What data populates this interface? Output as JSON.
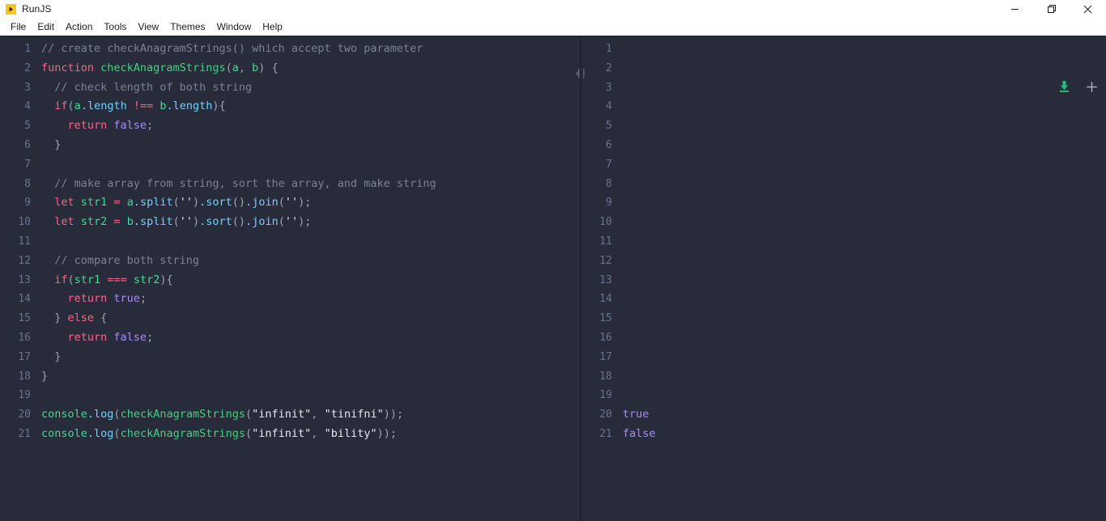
{
  "window": {
    "app_name": "RunJS",
    "app_icon": "play-icon",
    "controls": {
      "minimize": "minimize-icon",
      "maximize": "restore-icon",
      "close": "close-icon"
    }
  },
  "menubar": {
    "items": [
      {
        "label": "File"
      },
      {
        "label": "Edit"
      },
      {
        "label": "Action"
      },
      {
        "label": "Tools"
      },
      {
        "label": "View"
      },
      {
        "label": "Themes"
      },
      {
        "label": "Window"
      },
      {
        "label": "Help"
      }
    ]
  },
  "editor": {
    "line_numbers": [
      "1",
      "2",
      "3",
      "4",
      "5",
      "6",
      "7",
      "8",
      "9",
      "10",
      "11",
      "12",
      "13",
      "14",
      "15",
      "16",
      "17",
      "18",
      "19",
      "20",
      "21"
    ],
    "lines": [
      {
        "n": "1",
        "tokens": [
          {
            "t": "// create checkAnagramStrings() which accept two parameter",
            "c": "tok-comment"
          }
        ]
      },
      {
        "n": "2",
        "tokens": [
          {
            "t": "function ",
            "c": "tok-keyword"
          },
          {
            "t": "checkAnagramStrings",
            "c": "tok-func"
          },
          {
            "t": "(",
            "c": "tok-punct"
          },
          {
            "t": "a",
            "c": "tok-var"
          },
          {
            "t": ", ",
            "c": "tok-punct"
          },
          {
            "t": "b",
            "c": "tok-var"
          },
          {
            "t": ") {",
            "c": "tok-punct"
          }
        ]
      },
      {
        "n": "3",
        "tokens": [
          {
            "t": "  // check length of both string",
            "c": "tok-comment"
          }
        ]
      },
      {
        "n": "4",
        "tokens": [
          {
            "t": "  ",
            "c": "tok-plain"
          },
          {
            "t": "if",
            "c": "tok-keyword"
          },
          {
            "t": "(",
            "c": "tok-punct"
          },
          {
            "t": "a",
            "c": "tok-var"
          },
          {
            "t": ".length",
            "c": "tok-prop"
          },
          {
            "t": " !== ",
            "c": "tok-op"
          },
          {
            "t": "b",
            "c": "tok-var"
          },
          {
            "t": ".length",
            "c": "tok-prop"
          },
          {
            "t": "){",
            "c": "tok-punct"
          }
        ]
      },
      {
        "n": "5",
        "tokens": [
          {
            "t": "    ",
            "c": "tok-plain"
          },
          {
            "t": "return ",
            "c": "tok-keyword"
          },
          {
            "t": "false",
            "c": "tok-bool"
          },
          {
            "t": ";",
            "c": "tok-punct"
          }
        ]
      },
      {
        "n": "6",
        "tokens": [
          {
            "t": "  }",
            "c": "tok-punct"
          }
        ]
      },
      {
        "n": "7",
        "tokens": [
          {
            "t": "",
            "c": "tok-plain"
          }
        ]
      },
      {
        "n": "8",
        "tokens": [
          {
            "t": "  // make array from string, sort the array, and make string",
            "c": "tok-comment"
          }
        ]
      },
      {
        "n": "9",
        "tokens": [
          {
            "t": "  ",
            "c": "tok-plain"
          },
          {
            "t": "let ",
            "c": "tok-keyword"
          },
          {
            "t": "str1",
            "c": "tok-var"
          },
          {
            "t": " = ",
            "c": "tok-op"
          },
          {
            "t": "a",
            "c": "tok-var"
          },
          {
            "t": ".split",
            "c": "tok-prop"
          },
          {
            "t": "(",
            "c": "tok-punct"
          },
          {
            "t": "''",
            "c": "tok-string"
          },
          {
            "t": ")",
            "c": "tok-punct"
          },
          {
            "t": ".sort",
            "c": "tok-prop"
          },
          {
            "t": "()",
            "c": "tok-punct"
          },
          {
            "t": ".join",
            "c": "tok-prop"
          },
          {
            "t": "(",
            "c": "tok-punct"
          },
          {
            "t": "''",
            "c": "tok-string"
          },
          {
            "t": ");",
            "c": "tok-punct"
          }
        ]
      },
      {
        "n": "10",
        "tokens": [
          {
            "t": "  ",
            "c": "tok-plain"
          },
          {
            "t": "let ",
            "c": "tok-keyword"
          },
          {
            "t": "str2",
            "c": "tok-var"
          },
          {
            "t": " = ",
            "c": "tok-op"
          },
          {
            "t": "b",
            "c": "tok-var"
          },
          {
            "t": ".split",
            "c": "tok-prop"
          },
          {
            "t": "(",
            "c": "tok-punct"
          },
          {
            "t": "''",
            "c": "tok-string"
          },
          {
            "t": ")",
            "c": "tok-punct"
          },
          {
            "t": ".sort",
            "c": "tok-prop"
          },
          {
            "t": "()",
            "c": "tok-punct"
          },
          {
            "t": ".join",
            "c": "tok-prop"
          },
          {
            "t": "(",
            "c": "tok-punct"
          },
          {
            "t": "''",
            "c": "tok-string"
          },
          {
            "t": ");",
            "c": "tok-punct"
          }
        ]
      },
      {
        "n": "11",
        "tokens": [
          {
            "t": "",
            "c": "tok-plain"
          }
        ]
      },
      {
        "n": "12",
        "tokens": [
          {
            "t": "  // compare both string",
            "c": "tok-comment"
          }
        ]
      },
      {
        "n": "13",
        "tokens": [
          {
            "t": "  ",
            "c": "tok-plain"
          },
          {
            "t": "if",
            "c": "tok-keyword"
          },
          {
            "t": "(",
            "c": "tok-punct"
          },
          {
            "t": "str1",
            "c": "tok-var"
          },
          {
            "t": " === ",
            "c": "tok-op"
          },
          {
            "t": "str2",
            "c": "tok-var"
          },
          {
            "t": "){",
            "c": "tok-punct"
          }
        ]
      },
      {
        "n": "14",
        "tokens": [
          {
            "t": "    ",
            "c": "tok-plain"
          },
          {
            "t": "return ",
            "c": "tok-keyword"
          },
          {
            "t": "true",
            "c": "tok-bool"
          },
          {
            "t": ";",
            "c": "tok-punct"
          }
        ]
      },
      {
        "n": "15",
        "tokens": [
          {
            "t": "  } ",
            "c": "tok-punct"
          },
          {
            "t": "else",
            "c": "tok-keyword"
          },
          {
            "t": " {",
            "c": "tok-punct"
          }
        ]
      },
      {
        "n": "16",
        "tokens": [
          {
            "t": "    ",
            "c": "tok-plain"
          },
          {
            "t": "return ",
            "c": "tok-keyword"
          },
          {
            "t": "false",
            "c": "tok-bool"
          },
          {
            "t": ";",
            "c": "tok-punct"
          }
        ]
      },
      {
        "n": "17",
        "tokens": [
          {
            "t": "  }",
            "c": "tok-punct"
          }
        ]
      },
      {
        "n": "18",
        "tokens": [
          {
            "t": "}",
            "c": "tok-punct"
          }
        ]
      },
      {
        "n": "19",
        "tokens": [
          {
            "t": "",
            "c": "tok-plain"
          }
        ]
      },
      {
        "n": "20",
        "tokens": [
          {
            "t": "console",
            "c": "tok-var"
          },
          {
            "t": ".log",
            "c": "tok-prop"
          },
          {
            "t": "(",
            "c": "tok-punct"
          },
          {
            "t": "checkAnagramStrings",
            "c": "tok-func"
          },
          {
            "t": "(",
            "c": "tok-punct"
          },
          {
            "t": "\"infinit\"",
            "c": "tok-string"
          },
          {
            "t": ", ",
            "c": "tok-punct"
          },
          {
            "t": "\"tinifni\"",
            "c": "tok-string"
          },
          {
            "t": "));",
            "c": "tok-punct"
          }
        ]
      },
      {
        "n": "21",
        "tokens": [
          {
            "t": "console",
            "c": "tok-var"
          },
          {
            "t": ".log",
            "c": "tok-prop"
          },
          {
            "t": "(",
            "c": "tok-punct"
          },
          {
            "t": "checkAnagramStrings",
            "c": "tok-func"
          },
          {
            "t": "(",
            "c": "tok-punct"
          },
          {
            "t": "\"infinit\"",
            "c": "tok-string"
          },
          {
            "t": ", ",
            "c": "tok-punct"
          },
          {
            "t": "\"bility\"",
            "c": "tok-string"
          },
          {
            "t": "));",
            "c": "tok-punct"
          }
        ]
      }
    ]
  },
  "output": {
    "toolbar": {
      "download_icon": "download-icon",
      "add_icon": "plus-icon"
    },
    "resize_handle_icon": "column-resize-icon",
    "lines": [
      {
        "n": "1",
        "value": ""
      },
      {
        "n": "2",
        "value": ""
      },
      {
        "n": "3",
        "value": ""
      },
      {
        "n": "4",
        "value": ""
      },
      {
        "n": "5",
        "value": ""
      },
      {
        "n": "6",
        "value": ""
      },
      {
        "n": "7",
        "value": ""
      },
      {
        "n": "8",
        "value": ""
      },
      {
        "n": "9",
        "value": ""
      },
      {
        "n": "10",
        "value": ""
      },
      {
        "n": "11",
        "value": ""
      },
      {
        "n": "12",
        "value": ""
      },
      {
        "n": "13",
        "value": ""
      },
      {
        "n": "14",
        "value": ""
      },
      {
        "n": "15",
        "value": ""
      },
      {
        "n": "16",
        "value": ""
      },
      {
        "n": "17",
        "value": ""
      },
      {
        "n": "18",
        "value": ""
      },
      {
        "n": "19",
        "value": ""
      },
      {
        "n": "20",
        "value": "true"
      },
      {
        "n": "21",
        "value": "false"
      }
    ]
  },
  "colors": {
    "background": "#282c3a",
    "titlebar": "#ffffff",
    "divider": "#20232e",
    "gutter_text": "#68748c",
    "comment": "#7a8296",
    "keyword": "#ff6188",
    "function": "#42d17f",
    "variable": "#3ddc97",
    "property": "#73d0ff",
    "string": "#e6e9f0",
    "boolean": "#a78bfa",
    "download_accent": "#2bb673"
  }
}
